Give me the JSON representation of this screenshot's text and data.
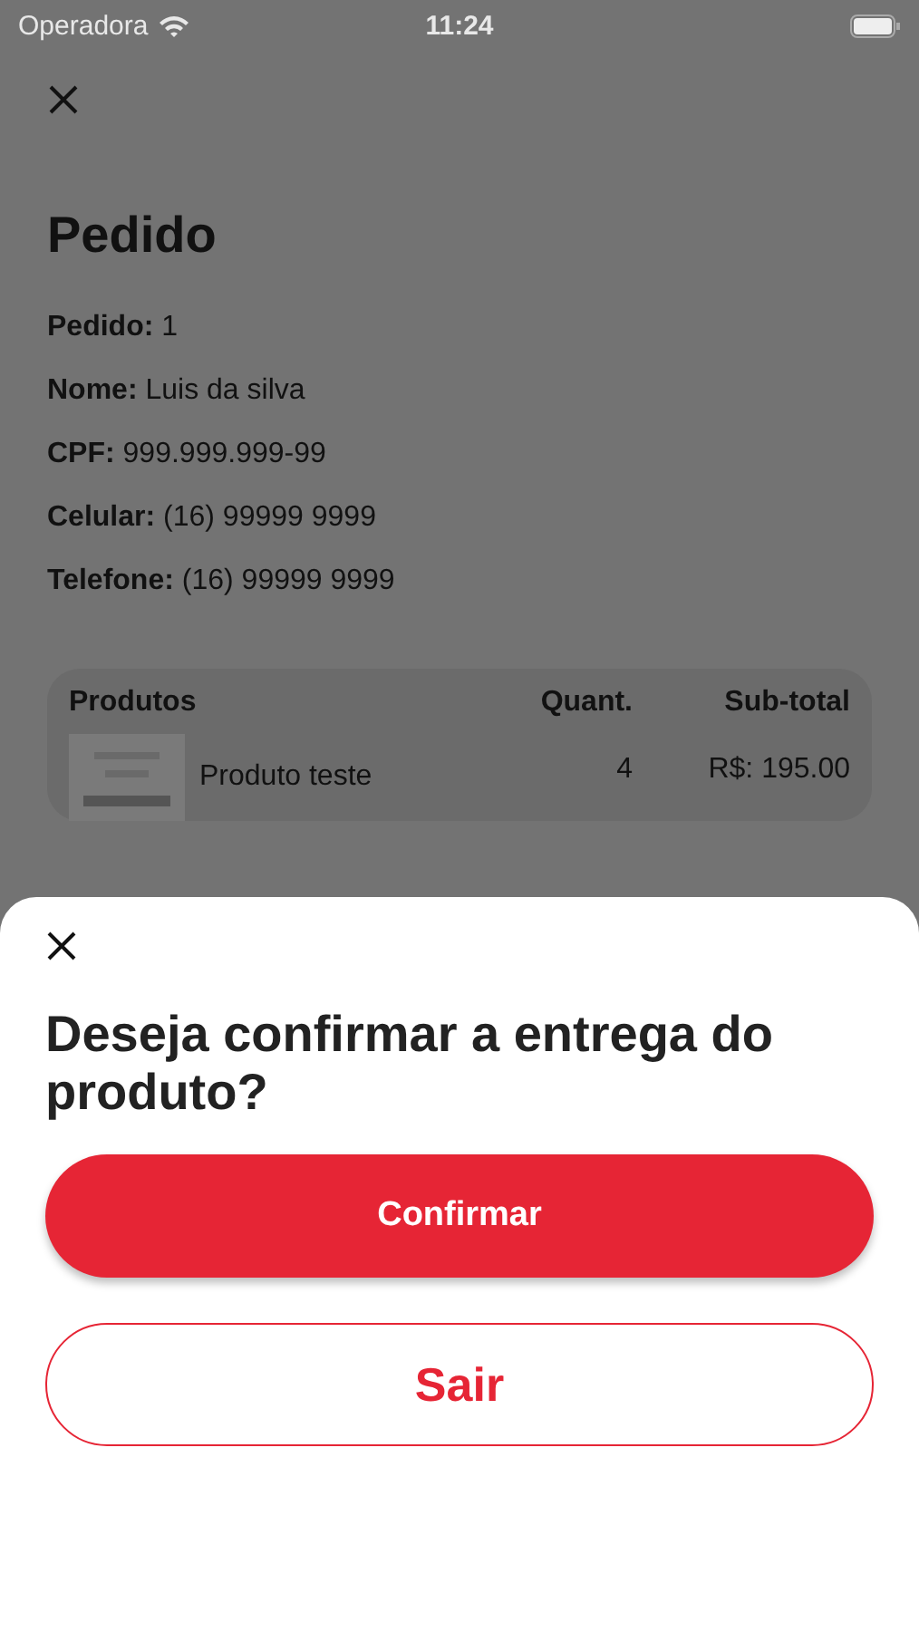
{
  "status_bar": {
    "carrier": "Operadora",
    "time": "11:24"
  },
  "page": {
    "title": "Pedido",
    "fields": [
      {
        "label": "Pedido:",
        "value": "1"
      },
      {
        "label": "Nome:",
        "value": "Luis da silva"
      },
      {
        "label": "CPF:",
        "value": "999.999.999-99"
      },
      {
        "label": "Celular:",
        "value": "(16) 99999 9999"
      },
      {
        "label": "Telefone:",
        "value": "(16) 99999 9999"
      }
    ]
  },
  "products": {
    "columns": [
      "Produtos",
      "Quant.",
      "Sub-total"
    ],
    "rows": [
      {
        "name": "Produto teste",
        "quantity": "4",
        "subtotal": "R$: 195.00"
      }
    ]
  },
  "sheet": {
    "question": "Deseja confirmar a entrega do produto?",
    "buttons": [
      {
        "label": "Confirmar",
        "kind": "primary"
      },
      {
        "label": "Sair",
        "kind": "outline"
      }
    ]
  }
}
